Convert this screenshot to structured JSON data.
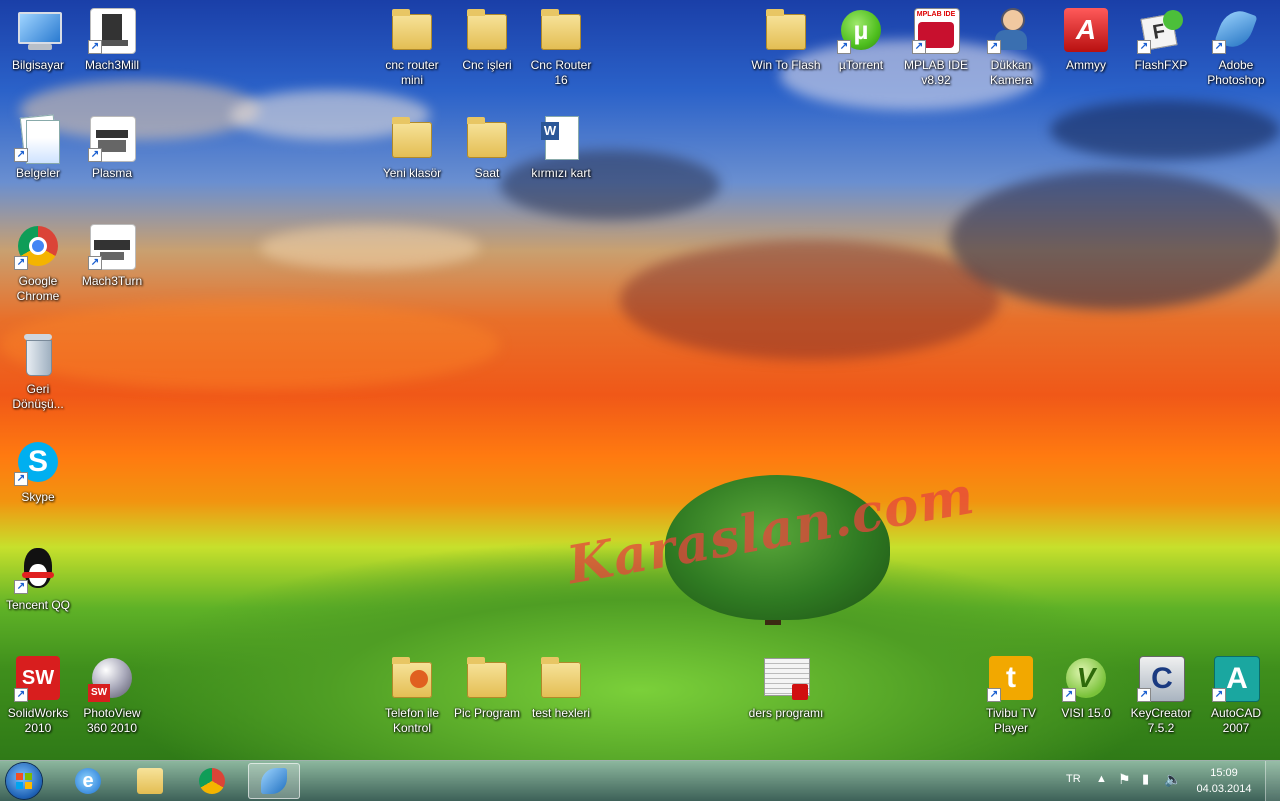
{
  "icons": {
    "bilgisayar": "Bilgisayar",
    "mach3mill": "Mach3Mill",
    "cnc_router_mini": "cnc router mini",
    "cnc_isleri": "Cnc işleri",
    "cnc_router_16": "Cnc Router 16",
    "win_to_flash": "Win To Flash",
    "utorrent": "µTorrent",
    "mplab_ide": "MPLAB IDE v8.92",
    "dukkan_kamera": "Dükkan Kamera",
    "ammyy": "Ammyy",
    "flashfxp": "FlashFXP",
    "adobe_photoshop": "Adobe Photoshop",
    "belgeler": "Belgeler",
    "plasma": "Plasma",
    "yeni_klasor": "Yeni klasör",
    "saat": "Saat",
    "kirmizi_kart": "kırmızı kart",
    "google_chrome": "Google Chrome",
    "mach3turn": "Mach3Turn",
    "geri_donusum": "Geri Dönüşü...",
    "skype": "Skype",
    "tencent_qq": "Tencent QQ",
    "solidworks": "SolidWorks 2010",
    "photoview": "PhotoView 360 2010",
    "telefon_kontrol": "Telefon ile Kontrol",
    "pic_program": "Pic Program",
    "test_hexleri": "test hexleri",
    "ders_programi": "ders programı",
    "tivibu": "Tivibu TV Player",
    "visi": "VISI 15.0",
    "keycreator": "KeyCreator 7.5.2",
    "autocad": "AutoCAD 2007"
  },
  "mplab_badge": "MPLAB IDE",
  "watermark": "Karaslan.com",
  "tray": {
    "language": "TR",
    "time": "15:09",
    "date": "04.03.2014"
  },
  "colors": {
    "skype": "#00aff0",
    "utorrent": "#4fbf1f",
    "ammyy": "#d82020",
    "tivibu": "#f2a800",
    "autocad": "#1aa7a0",
    "solidworks": "#d81e1e"
  }
}
